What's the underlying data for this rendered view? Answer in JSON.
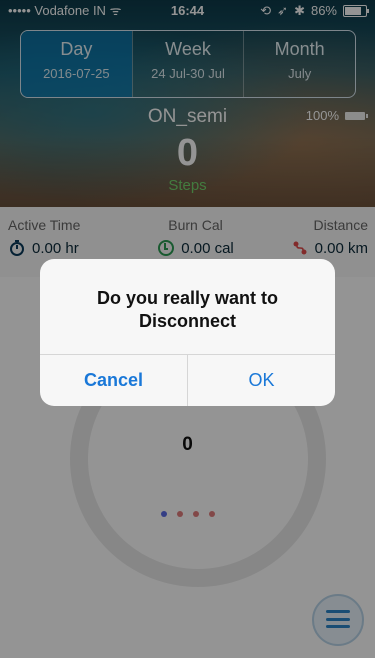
{
  "status_bar": {
    "carrier": "Vodafone IN",
    "time": "16:44",
    "battery_percent": "86%"
  },
  "segments": [
    {
      "title": "Day",
      "subtitle": "2016-07-25",
      "active": true
    },
    {
      "title": "Week",
      "subtitle": "24 Jul-30 Jul",
      "active": false
    },
    {
      "title": "Month",
      "subtitle": "July",
      "active": false
    }
  ],
  "device": {
    "name": "ON_semi",
    "battery": "100%"
  },
  "steps": {
    "value": "0",
    "label": "Steps"
  },
  "stats": {
    "active_time": {
      "label": "Active Time",
      "value": "0.00 hr",
      "icon": "stopwatch-icon"
    },
    "burn_cal": {
      "label": "Burn Cal",
      "value": "0.00 cal",
      "icon": "calorie-icon"
    },
    "distance": {
      "label": "Distance",
      "value": "0.00 km",
      "icon": "distance-icon"
    }
  },
  "ring": {
    "value": "0"
  },
  "page_dots": {
    "count": 4,
    "active_index": 0,
    "active_color": "#5A6BE6",
    "inactive_color": "#E07C7C"
  },
  "dialog": {
    "message": "Do you really want to Disconnect",
    "cancel_label": "Cancel",
    "ok_label": "OK"
  },
  "colors": {
    "accent_blue": "#1A78D8",
    "steps_label": "#74D46D",
    "segment_active": "#0980BE"
  }
}
